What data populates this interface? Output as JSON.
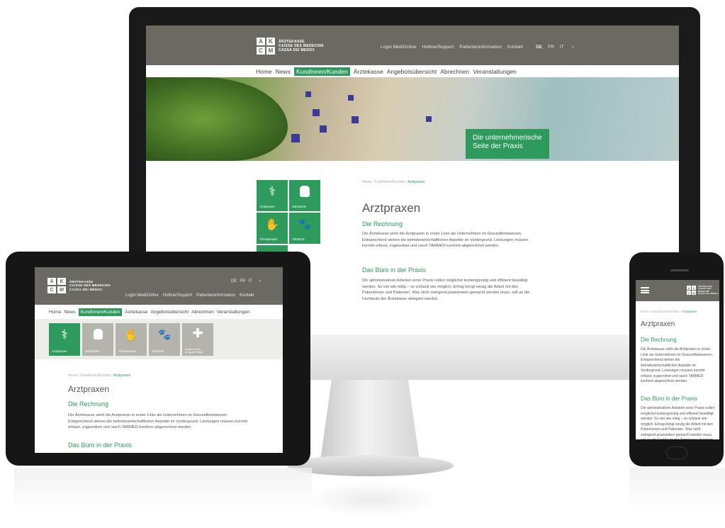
{
  "logo": {
    "letters": [
      "A",
      "K",
      "C",
      "M"
    ],
    "lines": [
      "ÄRZTEKASSE",
      "CAISSE DES MEDECINS",
      "CASSA DEI MEDICI"
    ]
  },
  "topbar": {
    "links": [
      "Login MediOnline",
      "Hotline/Support",
      "Patienteninformation",
      "Kontakt"
    ],
    "languages": [
      "DE",
      "FR",
      "IT"
    ],
    "search_icon": "search-icon"
  },
  "nav": {
    "items": [
      "Home",
      "News",
      "KundInnen/Kunden",
      "Ärztekasse",
      "Angebotsübersicht",
      "Abrechnen",
      "Veranstaltungen"
    ],
    "active_index": 2
  },
  "hero": {
    "caption_line1": "Die unternehmerische",
    "caption_line2": "Seite der Praxis"
  },
  "tiles": [
    {
      "label": "Arztpraxen",
      "icon": "stethoscope-icon",
      "glyph": "⚕"
    },
    {
      "label": "Zahnärzte",
      "icon": "tooth-icon",
      "glyph": "🦷"
    },
    {
      "label": "Therapeuten",
      "icon": "hands-icon",
      "glyph": "✋"
    },
    {
      "label": "Tierärzte",
      "icon": "paw-icon",
      "glyph": "🐾"
    },
    {
      "label": "Andere Leis-tungserbringer",
      "icon": "bandage-icon",
      "glyph": "✚"
    }
  ],
  "breadcrumb": {
    "parts": "Home / KundInnen/Kunden / ",
    "current": "Arztpraxen"
  },
  "content": {
    "title": "Arztpraxen",
    "section1_title": "Die Rechnung",
    "section1_text": "Die Ärztekasse sieht die Arztpraxen in erster Linie als Unternehmen im Gesundheitswesen. Entsprechend stehen die betriebswirtschaftlichen Aspekte im Vordergrund. Leistungen müssen korrekt erfasst, zugeordnet und rasch TARMED-konform abgerechnet werden.",
    "section2_title": "Das Büro in der Praxis",
    "section2_text": "Die administrativen Arbeiten einer Praxis sollen möglichst kostengünstig und effizient bewältigt werden. So viel wie nötig – so schlank wie möglich. Ertrag bringt einzig die Arbeit mit den Patientinnen und Patienten. Was nicht zwingend praxisintern gemacht werden muss, soll an die Fachleute der Ärztekasse delegiert werden."
  },
  "phone": {
    "menu_icon": "hamburger-icon"
  },
  "colors": {
    "header": "#6a6a63",
    "accent": "#2e9b5c",
    "tile_grey": "#b4b4ad"
  }
}
